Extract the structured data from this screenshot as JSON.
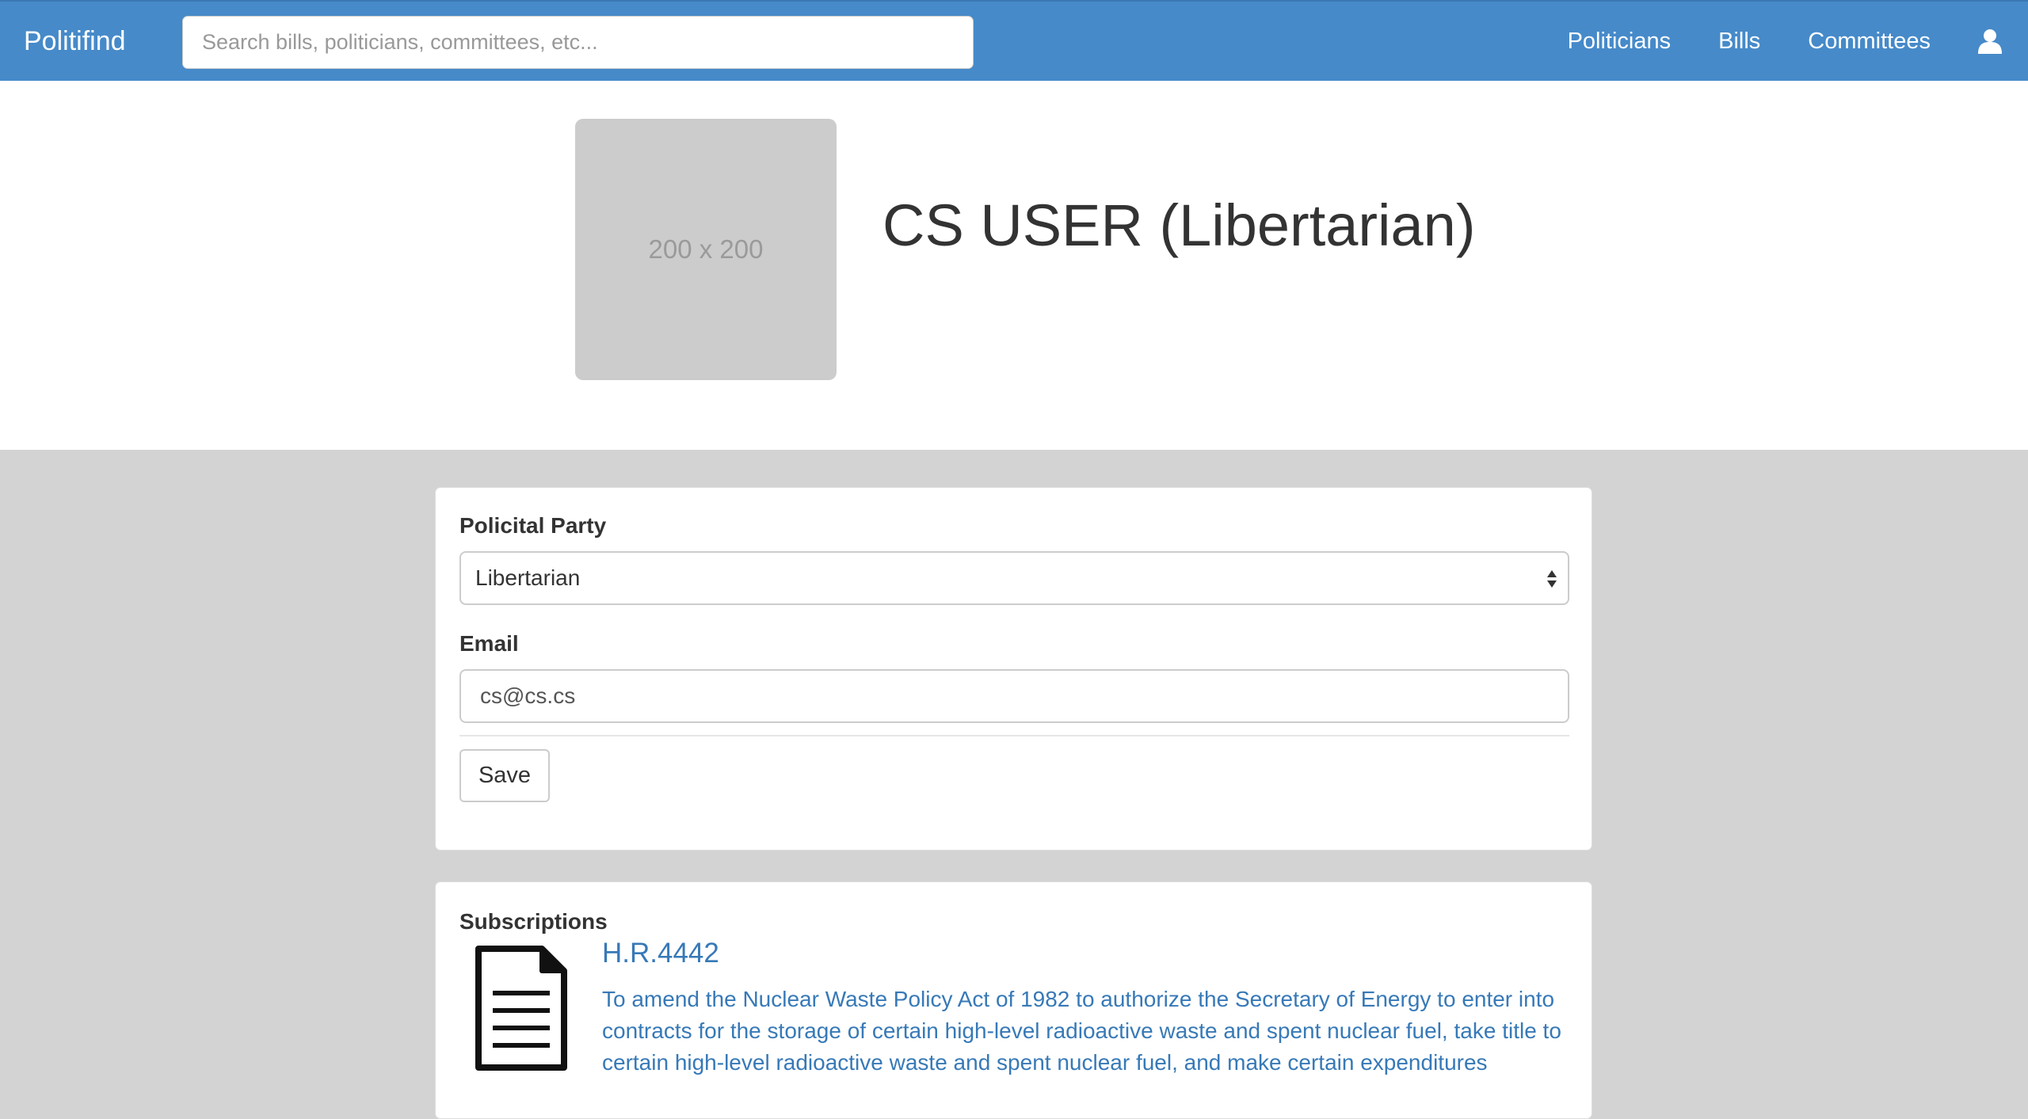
{
  "navbar": {
    "brand": "Politifind",
    "search_placeholder": "Search bills, politicians, committees, etc...",
    "links": [
      "Politicians",
      "Bills",
      "Committees"
    ],
    "user_icon": "user-icon",
    "background_color": "#468ac9"
  },
  "profile": {
    "avatar_placeholder": "200 x 200",
    "title": "CS USER (Libertarian)"
  },
  "settings": {
    "party_label": "Policital Party",
    "party_value": "Libertarian",
    "email_label": "Email",
    "email_value": "cs@cs.cs",
    "save_label": "Save"
  },
  "subscriptions": {
    "heading": "Subscriptions",
    "items": [
      {
        "icon": "document-icon",
        "bill": "H.R.4442",
        "description": "To amend the Nuclear Waste Policy Act of 1982 to authorize the Secretary of Energy to enter into contracts for the storage of certain high-level radioactive waste and spent nuclear fuel, take title to certain high-level radioactive waste and spent nuclear fuel, and make certain expenditures"
      }
    ]
  },
  "colors": {
    "link": "#3779b7",
    "page_background": "#d3d3d3"
  }
}
